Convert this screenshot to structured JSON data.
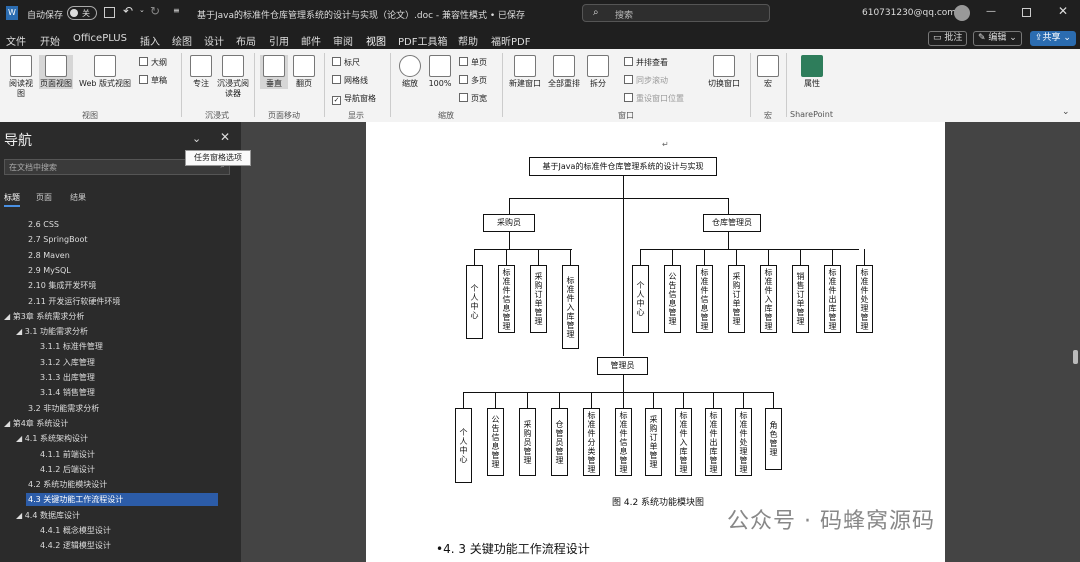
{
  "titlebar": {
    "autosave_label": "自动保存",
    "toggle_state": "关",
    "title": "基于Java的标准件仓库管理系统的设计与实现（论文）.doc  -  兼容性模式 • 已保存",
    "search_placeholder": "搜索",
    "account": "610731230@qq.com"
  },
  "menubar": {
    "items": [
      "文件",
      "开始",
      "OfficePLUS",
      "插入",
      "绘图",
      "设计",
      "布局",
      "引用",
      "邮件",
      "审阅",
      "视图",
      "PDF工具箱",
      "帮助",
      "福昕PDF"
    ],
    "comment_label": "批注",
    "edit_label": "编辑",
    "share_label": "共享"
  },
  "ribbon": {
    "read_view": "阅读视图",
    "page_view": "页面视图",
    "web_view": "Web 版式视图",
    "outline": "大纲",
    "draft": "草稿",
    "group_view": "视图",
    "focus": "专注",
    "immersive_reader": "沉浸式阅读器",
    "group_immersive": "沉浸式",
    "vertical": "垂直",
    "side_to_side": "翻页",
    "group_page_move": "页面移动",
    "ruler": "标尺",
    "gridlines": "网格线",
    "nav_pane": "导航窗格",
    "group_show": "显示",
    "zoom": "缩放",
    "hundred": "100%",
    "one_page": "单页",
    "multi_page": "多页",
    "page_width": "页宽",
    "group_zoom": "缩放",
    "new_window": "新建窗口",
    "arrange_all": "全部重排",
    "split": "拆分",
    "side_by_side": "并排查看",
    "sync_scroll": "同步滚动",
    "reset_window": "重设窗口位置",
    "switch_window": "切换窗口",
    "group_window": "窗口",
    "macros": "宏",
    "group_macros": "宏",
    "properties": "属性",
    "group_sharepoint": "SharePoint"
  },
  "nav": {
    "title": "导航",
    "search_placeholder": "在文档中搜索",
    "tooltip": "任务窗格选项",
    "tabs": [
      "标题",
      "页面",
      "结果"
    ],
    "items": [
      {
        "text": "2.6  CSS",
        "indent": 28
      },
      {
        "text": "2.7 SpringBoot",
        "indent": 28
      },
      {
        "text": "2.8   Maven",
        "indent": 28
      },
      {
        "text": "2.9  MySQL",
        "indent": 28
      },
      {
        "text": "2.10  集成开发环境",
        "indent": 28
      },
      {
        "text": "2.11  开发运行软硬件环境",
        "indent": 28
      },
      {
        "text": "◢  第3章  系统需求分析",
        "indent": 4
      },
      {
        "text": "◢  3.1  功能需求分析",
        "indent": 16
      },
      {
        "text": "3.1.1  标准件管理",
        "indent": 40
      },
      {
        "text": "3.1.2  入库管理",
        "indent": 40
      },
      {
        "text": "3.1.3  出库管理",
        "indent": 40
      },
      {
        "text": "3.1.4  销售管理",
        "indent": 40
      },
      {
        "text": "3.2  非功能需求分析",
        "indent": 28
      },
      {
        "text": "◢  第4章  系统设计",
        "indent": 4
      },
      {
        "text": "◢  4.1  系统架构设计",
        "indent": 16
      },
      {
        "text": "4.1.1  前端设计",
        "indent": 40
      },
      {
        "text": "4.1.2  后端设计",
        "indent": 40
      },
      {
        "text": "4.2  系统功能模块设计",
        "indent": 28
      },
      {
        "text": "4.3  关键功能工作流程设计",
        "indent": 28,
        "selected": true
      },
      {
        "text": "◢  4.4  数据库设计",
        "indent": 16
      },
      {
        "text": "4.4.1  概念模型设计",
        "indent": 40
      },
      {
        "text": "4.4.2  逻辑模型设计",
        "indent": 40
      }
    ]
  },
  "doc": {
    "root": "基于Java的标准件仓库管理系统的设计与实现",
    "purchaser": "采购员",
    "warehouse_manager": "仓库管理员",
    "admin": "管理员",
    "purchaser_modules": [
      "个人中心",
      "标准件信息管理",
      "采购订单管理",
      "标准件入库管理"
    ],
    "warehouse_modules": [
      "个人中心",
      "公告信息管理",
      "标准件信息管理",
      "采购订单管理",
      "标准件入库管理",
      "销售订单管理",
      "标准件出库管理",
      "标准件处理管理"
    ],
    "admin_modules": [
      "个人中心",
      "公告信息管理",
      "采购员管理",
      "仓管员管理",
      "标准件分类管理",
      "标准件信息管理",
      "采购订单管理",
      "标准件入库管理",
      "标准件出库管理",
      "标准件处理管理",
      "角色管理"
    ],
    "caption": "图 4.2  系统功能模块图",
    "heading": "•4. 3    关键功能工作流程设计",
    "watermark": "公众号 · 码蜂窝源码"
  }
}
